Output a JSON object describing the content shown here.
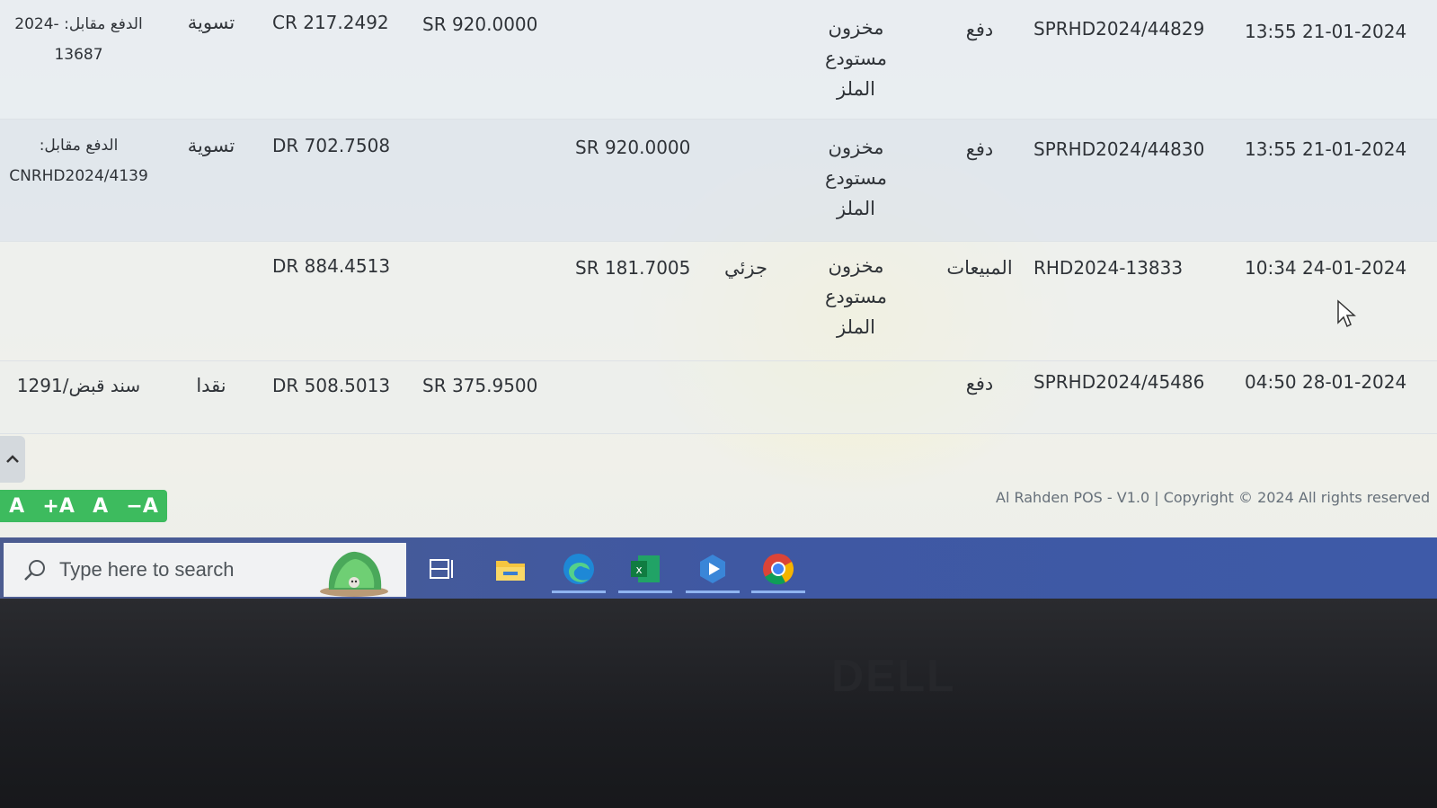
{
  "transactions": {
    "rows": [
      {
        "date": "13:55 21-01-2024",
        "reference": "SPRHD2024/44829",
        "type": "دفع",
        "store": "مخزون مستودع الملز",
        "payment_status": "",
        "sr2": "",
        "sr1": "SR 920.0000",
        "balance": "CR 217.2492",
        "method": "تسوية",
        "note": "الدفع مقابل: -2024 13687"
      },
      {
        "date": "13:55 21-01-2024",
        "reference": "SPRHD2024/44830",
        "type": "دفع",
        "store": "مخزون مستودع الملز",
        "payment_status": "",
        "sr2": "SR 920.0000",
        "sr1": "",
        "balance": "DR 702.7508",
        "method": "تسوية",
        "note": "الدفع مقابل: CNRHD2024/4139"
      },
      {
        "date": "10:34 24-01-2024",
        "reference": "RHD2024-13833",
        "type": "المبيعات",
        "store": "مخزون مستودع الملز",
        "payment_status": "جزئي",
        "sr2": "SR 181.7005",
        "sr1": "",
        "balance": "DR 884.4513",
        "method": "",
        "note": ""
      },
      {
        "date": "04:50 28-01-2024",
        "reference": "SPRHD2024/45486",
        "type": "دفع",
        "store": "",
        "payment_status": "",
        "sr2": "",
        "sr1": "SR 375.9500",
        "balance": "DR 508.5013",
        "method": "نقدا",
        "note": "سند قبض/1291"
      }
    ]
  },
  "font_controls": {
    "reset": "A",
    "increase": "+A",
    "normal": "A",
    "decrease": "−A"
  },
  "footer": {
    "copyright": "Al Rahden POS - V1.0 | Copyright © 2024 All rights reserved"
  },
  "taskbar": {
    "search_placeholder": "Type here to search",
    "icons": [
      "task-view-icon",
      "file-explorer-icon",
      "edge-icon",
      "excel-icon",
      "media-app-icon",
      "chrome-icon"
    ]
  },
  "bezel": {
    "brand": "DELL"
  },
  "colors": {
    "font_bar": "#3dbb5e",
    "taskbar": "#3f58a2",
    "text": "#2f3338"
  }
}
